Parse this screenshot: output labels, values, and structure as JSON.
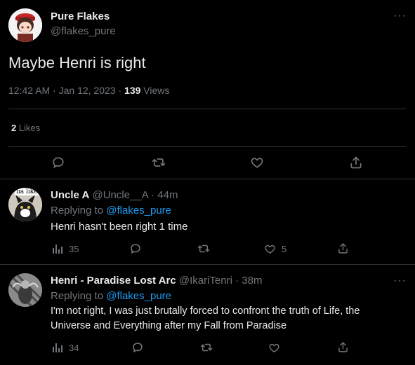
{
  "colors": {
    "background": "#000000",
    "text": "#e7e9ea",
    "muted": "#71767b",
    "link": "#1d9bf0",
    "border": "#2f3336"
  },
  "main_tweet": {
    "author_name": "Pure Flakes",
    "author_handle": "@flakes_pure",
    "text": "Maybe Henri is right",
    "time": "12:42 AM",
    "sep1": "·",
    "date": "Jan 12, 2023",
    "sep2": "·",
    "views_count": "139",
    "views_label": "Views",
    "likes_count": "2",
    "likes_label": "Likes",
    "icons": [
      "reply-icon",
      "retweet-icon",
      "like-icon",
      "share-icon"
    ]
  },
  "replies": [
    {
      "author_name": "Uncle A",
      "author_handle": "@Uncle__A",
      "sep": "·",
      "time": "44m",
      "avatar_label": "lia liker",
      "replying_label": "Replying to",
      "replying_handle": "@flakes_pure",
      "text": "Henri hasn't been right 1 time",
      "views": "35",
      "likes": "5"
    },
    {
      "author_name": "Henri - Paradise Lost Arc",
      "author_handle": "@IkariTenri",
      "sep": "·",
      "time": "38m",
      "replying_label": "Replying to",
      "replying_handle": "@flakes_pure",
      "text_line1": "I'm not right, I was just brutally forced to confront the truth of Life, the",
      "text_line2": "Universe and Everything after my Fall from Paradise",
      "views": "34"
    }
  ]
}
